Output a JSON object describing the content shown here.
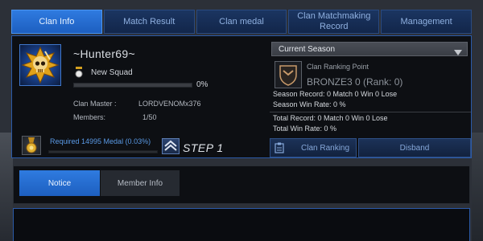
{
  "tabs": [
    {
      "label": "Clan Info",
      "active": true
    },
    {
      "label": "Match Result",
      "active": false
    },
    {
      "label": "Clan medal",
      "active": false
    },
    {
      "label": "Clan Matchmaking Record",
      "active": false
    },
    {
      "label": "Management",
      "active": false
    }
  ],
  "clan": {
    "name": "~Hunter69~",
    "squad": "New Squad",
    "exp_percent_label": "0%",
    "exp_progress": 0,
    "master_label": "Clan Master :",
    "master_value": "LORDVENOMx376",
    "members_label": "Members:",
    "members_value": "1/50"
  },
  "medal": {
    "required_text": "Required 14995 Medal (0.03%)",
    "progress": 0.0003,
    "step_label": "STEP 1"
  },
  "season": {
    "selected": "Current Season",
    "rank_point_label": "Clan Ranking Point",
    "rank_value": "BRONZE3 0 (Rank: 0)",
    "season_record": "Season Record: 0 Match 0 Win 0 Lose",
    "season_winrate": "Season Win Rate: 0 %",
    "total_record": "Total Record: 0 Match 0 Win 0 Lose",
    "total_winrate": "Total Win Rate: 0 %",
    "clan_ranking_button": "Clan Ranking",
    "disband_button": "Disband"
  },
  "subtabs": [
    {
      "label": "Notice",
      "active": true
    },
    {
      "label": "Member Info",
      "active": false
    }
  ],
  "colors": {
    "accent": "#2f7be0",
    "panel_border": "#2b5aa8",
    "link_blue": "#5a9ae6"
  },
  "icons": {
    "clan_emblem": "skull-emblem-icon",
    "squad": "squad-rank-icon",
    "medal": "medal-icon",
    "step": "chevron-up-rank-icon",
    "rank": "bronze-shield-icon",
    "clan_ranking": "clipboard-icon",
    "dropdown": "triangle-down-icon"
  }
}
